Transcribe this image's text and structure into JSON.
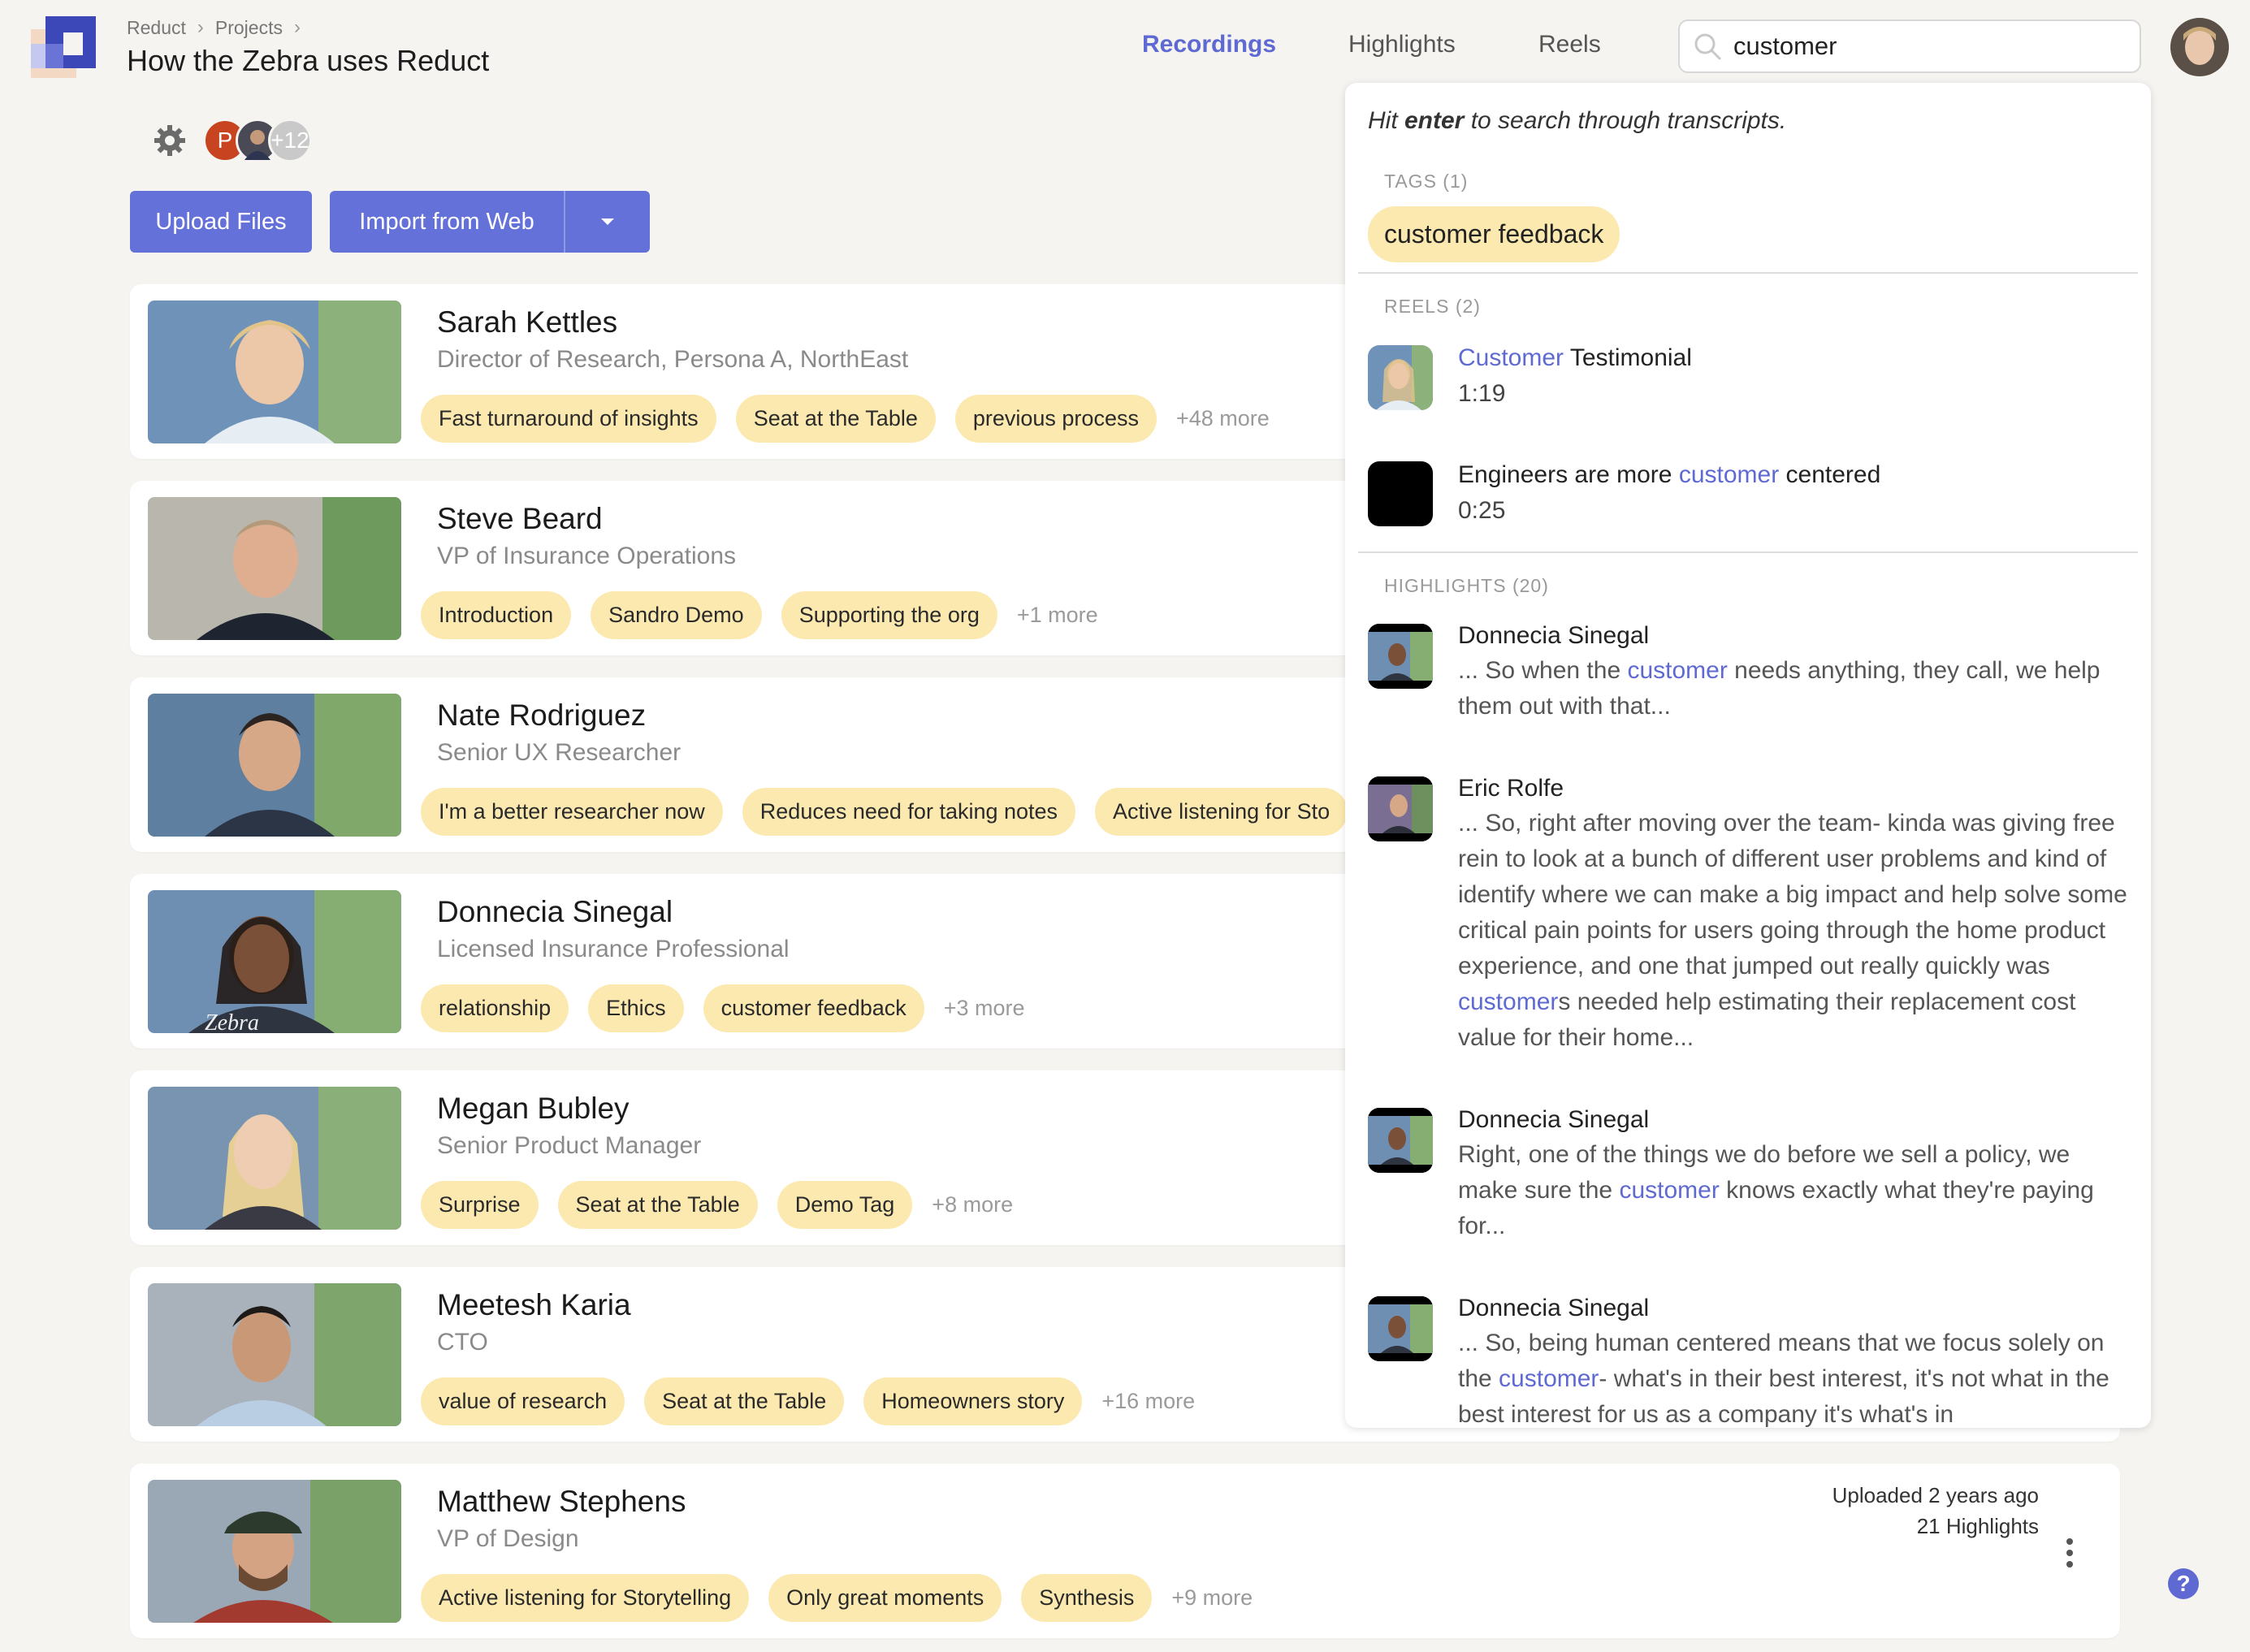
{
  "breadcrumb": [
    "Reduct",
    "Projects"
  ],
  "page_title": "How the Zebra uses Reduct",
  "nav": {
    "recordings": "Recordings",
    "highlights": "Highlights",
    "reels": "Reels"
  },
  "search": {
    "value": "customer"
  },
  "members": {
    "initial": "P",
    "extra_count": "+12"
  },
  "buttons": {
    "upload": "Upload Files",
    "import": "Import from Web"
  },
  "recordings": [
    {
      "name": "Sarah Kettles",
      "role": "Director of Research, Persona A, NorthEast",
      "tags": [
        "Fast turnaround of insights",
        "Seat at the Table",
        "previous process"
      ],
      "more": "+48 more"
    },
    {
      "name": "Steve Beard",
      "role": "VP of Insurance Operations",
      "tags": [
        "Introduction",
        "Sandro Demo",
        "Supporting the org"
      ],
      "more": "+1 more"
    },
    {
      "name": "Nate Rodriguez",
      "role": "Senior UX Researcher",
      "tags": [
        "I'm a better researcher now",
        "Reduces need for taking notes",
        "Active listening for Sto"
      ],
      "more": ""
    },
    {
      "name": "Donnecia Sinegal",
      "role": "Licensed Insurance Professional",
      "tags": [
        "relationship",
        "Ethics",
        "customer feedback"
      ],
      "more": "+3 more"
    },
    {
      "name": "Megan Bubley",
      "role": "Senior Product Manager",
      "tags": [
        "Surprise",
        "Seat at the Table",
        "Demo Tag"
      ],
      "more": "+8 more"
    },
    {
      "name": "Meetesh Karia",
      "role": "CTO",
      "tags": [
        "value of research",
        "Seat at the Table",
        "Homeowners story"
      ],
      "more": "+16 more"
    },
    {
      "name": "Matthew Stephens",
      "role": "VP of Design",
      "tags": [
        "Active listening for Storytelling",
        "Only great moments",
        "Synthesis"
      ],
      "more": "+9 more",
      "uploaded": "Uploaded 2 years ago",
      "highlights": "21 Highlights"
    }
  ],
  "dropdown": {
    "hint_a": "Hit ",
    "hint_b": "enter",
    "hint_c": " to search through transcripts.",
    "tags_label": "TAGS (1)",
    "tag": "customer feedback",
    "reels_label": "REELS (2)",
    "reels": [
      {
        "hl": "Customer",
        "rest": " Testimonial",
        "duration": "1:19"
      },
      {
        "pre": "Engineers are more ",
        "hl": "customer",
        "post": " centered",
        "duration": "0:25"
      }
    ],
    "highlights_label": "HIGHLIGHTS (20)",
    "highlights": [
      {
        "name": "Donnecia Sinegal",
        "pre": "... So when the ",
        "hl": "customer",
        "post": " needs anything, they call, we help them out with that..."
      },
      {
        "name": "Eric Rolfe",
        "pre": "... So, right after moving over the team- kinda was giving free rein to look at a bunch of different user problems and kind of identify where we can make a big impact and help solve some critical pain points for users going through the home product experience, and one that jumped out really quickly was ",
        "hl": "customer",
        "post": "s needed help estimating their replacement cost value for their home..."
      },
      {
        "name": "Donnecia Sinegal",
        "pre": "Right, one of the things we do before we sell a policy, we make sure the ",
        "hl": "customer",
        "post": " knows exactly what they're paying for..."
      },
      {
        "name": "Donnecia Sinegal",
        "pre": "... So, being human centered means that we focus solely on the ",
        "hl": "customer",
        "post": "- what's in their best interest, it's not what in the best interest for us as a company it's what's in"
      }
    ]
  },
  "help": "?",
  "colors": {
    "accent": "#5e6ad2",
    "tag_bg": "#fbe9b0",
    "button": "#6471d9"
  }
}
